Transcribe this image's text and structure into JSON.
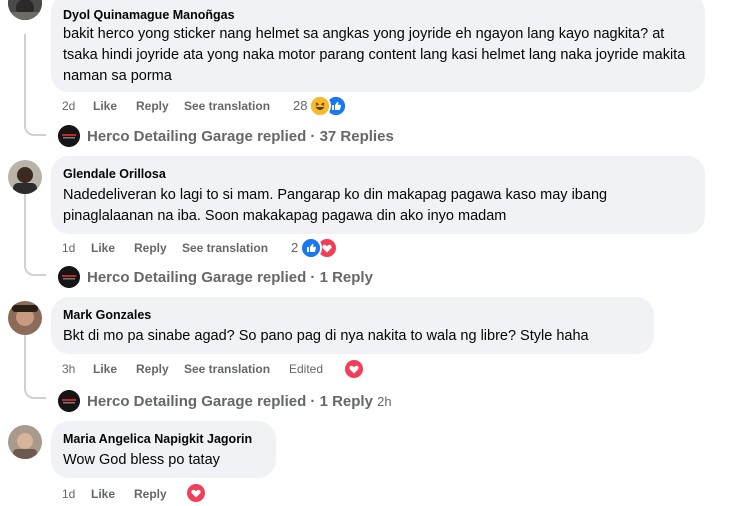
{
  "comments": [
    {
      "author": "Dyol Quinamague Manoñgas",
      "text": "bakit herco yong sticker nang helmet sa angkas yong joyride eh ngayon lang kayo nagkita? at tsaka hindi joyride ata yong naka motor parang content lang kasi helmet lang naka joyride makita naman sa porma",
      "time": "2d",
      "like": "Like",
      "reply": "Reply",
      "see_translation": "See translation",
      "reaction_count": "28",
      "reactions": [
        "haha-icon",
        "like-icon"
      ],
      "replies": {
        "name": "Herco Detailing Garage",
        "label": "replied · 37 Replies",
        "time": ""
      }
    },
    {
      "author": "Glendale Orillosa",
      "text": "Nadedeliveran ko lagi to si mam. Pangarap ko din makapag pagawa kaso may ibang pinaglalaanan na iba. Soon makakapag pagawa din ako inyo madam",
      "time": "1d",
      "like": "Like",
      "reply": "Reply",
      "see_translation": "See translation",
      "reaction_count": "2",
      "reactions": [
        "like-icon",
        "love-icon"
      ],
      "replies": {
        "name": "Herco Detailing Garage",
        "label": "replied · 1 Reply",
        "time": ""
      }
    },
    {
      "author": "Mark Gonzales",
      "text": "Bkt di mo pa sinabe agad? So pano pag di nya nakita to wala ng libre? Style haha",
      "time": "3h",
      "like": "Like",
      "reply": "Reply",
      "see_translation": "See translation",
      "edited": "Edited",
      "reaction_count": "",
      "reactions": [
        "love-icon"
      ],
      "replies": {
        "name": "Herco Detailing Garage",
        "label": "replied · 1 Reply",
        "time": "2h"
      }
    },
    {
      "author": "Maria Angelica Napigkit Jagorin",
      "text": "Wow God bless po tatay",
      "time": "1d",
      "like": "Like",
      "reply": "Reply",
      "reaction_count": "",
      "reactions": [
        "love-icon"
      ]
    }
  ],
  "colors": {
    "bubble": "#f0f2f5",
    "meta_text": "#65676b",
    "like_blue": "#1877f2",
    "love_red": "#f33e58",
    "haha_yellow": "#f7b928",
    "thread_line": "#ced0d4"
  }
}
